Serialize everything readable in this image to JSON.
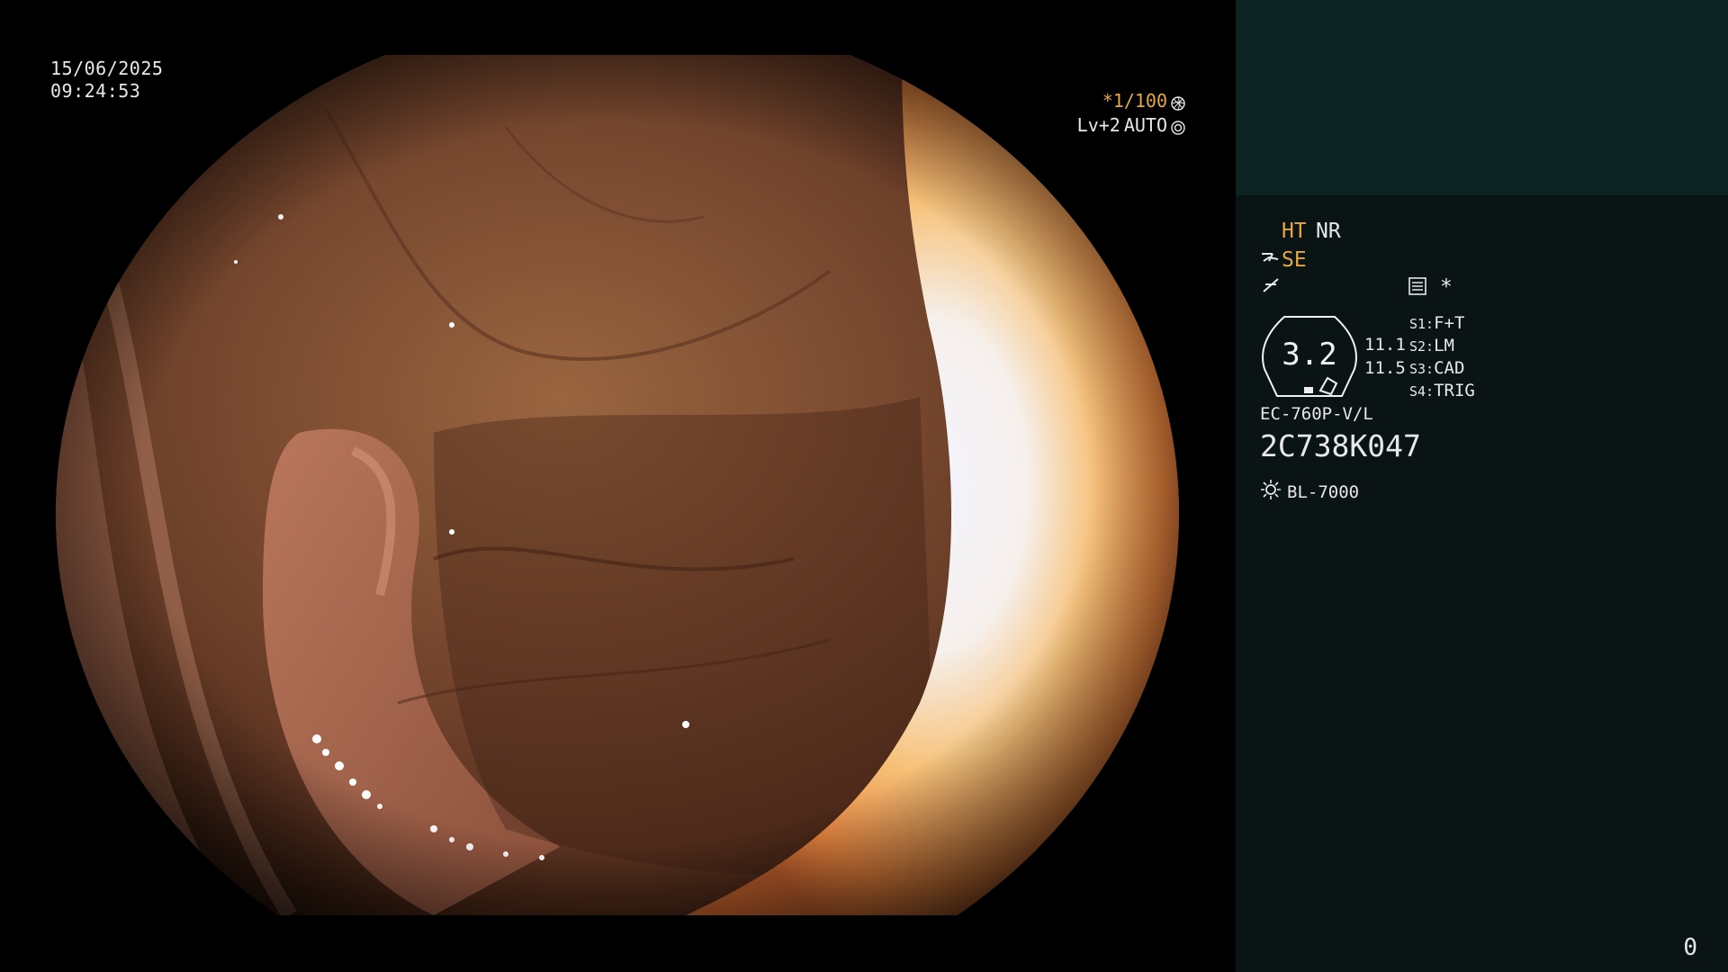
{
  "overlay": {
    "date": "15/06/2025",
    "time": "09:24:53",
    "shutter": "*1/100",
    "level": "Lv+2",
    "auto": "AUTO"
  },
  "panel": {
    "ht": "HT",
    "nr": "NR",
    "se": "SE",
    "asterisk": "*",
    "badge_value": "3.2",
    "val_upper": "11.1",
    "val_lower": "11.5",
    "switches": [
      {
        "key": "S1:",
        "val": "F+T"
      },
      {
        "key": "S2:",
        "val": "LM"
      },
      {
        "key": "S3:",
        "val": "CAD"
      },
      {
        "key": "S4:",
        "val": "TRIG"
      }
    ],
    "scope_model": "EC-760P-V/L",
    "serial": "2C738K047",
    "light_source": "BL-7000",
    "page": "0"
  },
  "colors": {
    "accent_orange": "#e6a744",
    "panel_bg": "#0a1414",
    "panel_top_bg": "#0e2324"
  },
  "icons": {
    "shutter": "aperture-icon",
    "auto": "iris-icon",
    "scope_tip": "scope-tip-icon",
    "structure": "structure-enhance-icon",
    "menu": "settings-card-icon",
    "light": "sun-icon"
  }
}
